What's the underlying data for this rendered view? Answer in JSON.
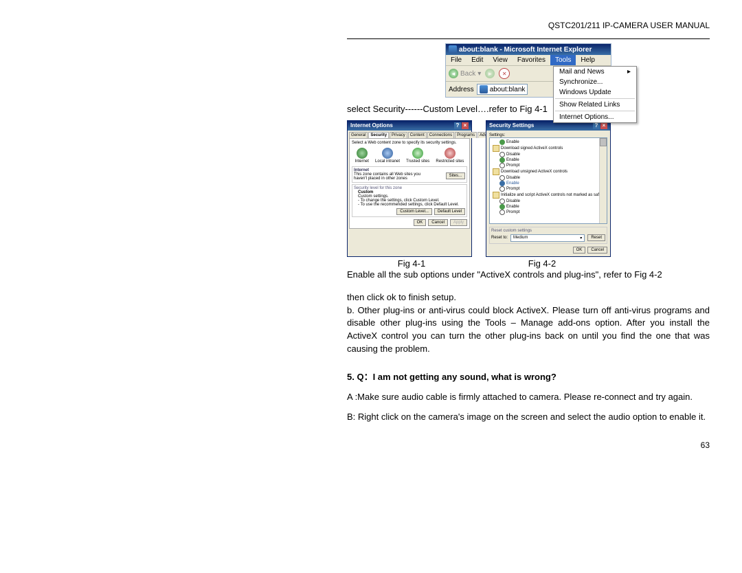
{
  "header": {
    "title": "QSTC201/211 IP-CAMERA USER MANUAL"
  },
  "ie_window": {
    "title": "about:blank - Microsoft Internet Explorer",
    "menus": [
      "File",
      "Edit",
      "View",
      "Favorites",
      "Tools",
      "Help"
    ],
    "dropdown": {
      "items": [
        "Mail and News",
        "Synchronize...",
        "Windows Update",
        "Show Related Links",
        "Internet Options..."
      ]
    },
    "toolbar": {
      "back_label": "Back"
    },
    "address_label": "Address",
    "address_value": "about:blank"
  },
  "text": {
    "step_select": " select Security------Custom Level….refer to Fig 4-1",
    "fig41": "Fig 4-1",
    "fig42": "Fig 4-2",
    "step_enable": " Enable all the sub options under \"ActiveX controls and plug-ins\", refer to Fig 4-2",
    "step_ok": " then click ok to finish setup.",
    "para_b": "b. Other plug-ins or anti-virus could block ActiveX. Please turn off anti-virus programs and disable other plug-ins using the Tools – Manage add-ons option. After you install the ActiveX control you can turn the other plug-ins back on until you find the one that was causing the problem.",
    "q5_title": "5.  Q：I am not getting any sound, what is wrong?",
    "q5_a": "A :Make sure audio cable is firmly attached to camera. Please re-connect and try again.",
    "q5_b": "B: Right click on the camera's image on the screen and select the audio option to enable it.",
    "page_number": "63"
  },
  "dlg_internet_options": {
    "title": "Internet Options",
    "tabs": [
      "General",
      "Security",
      "Privacy",
      "Content",
      "Connections",
      "Programs",
      "Advanced"
    ],
    "prompt": "Select a Web content zone to specify its security settings.",
    "zones": [
      "Internet",
      "Local intranet",
      "Trusted sites",
      "Restricted sites"
    ],
    "zone_title": "Internet",
    "zone_desc": "This zone contains all Web sites you haven't placed in other zones",
    "sites_btn": "Sites...",
    "security_level_label": "Security level for this zone",
    "custom_label": "Custom",
    "custom_line1": "Custom settings.",
    "custom_line2": "- To change the settings, click Custom Level.",
    "custom_line3": "- To use the recommended settings, click Default Level.",
    "btn_custom": "Custom Level...",
    "btn_default": "Default Level",
    "btn_ok": "OK",
    "btn_cancel": "Cancel",
    "btn_apply": "Apply"
  },
  "dlg_security_settings": {
    "title": "Security Settings",
    "settings_label": "Settings:",
    "items": {
      "n1": "Download signed ActiveX controls",
      "n2": "Download unsigned ActiveX controls",
      "n3": "Initialize and script ActiveX controls not marked as safe",
      "r_enable": "Enable",
      "r_disable": "Disable",
      "r_prompt": "Prompt"
    },
    "reset_label": "Reset custom settings",
    "reset_to": "Reset to:",
    "reset_value": "Medium",
    "btn_reset": "Reset",
    "btn_ok": "OK",
    "btn_cancel": "Cancel"
  }
}
